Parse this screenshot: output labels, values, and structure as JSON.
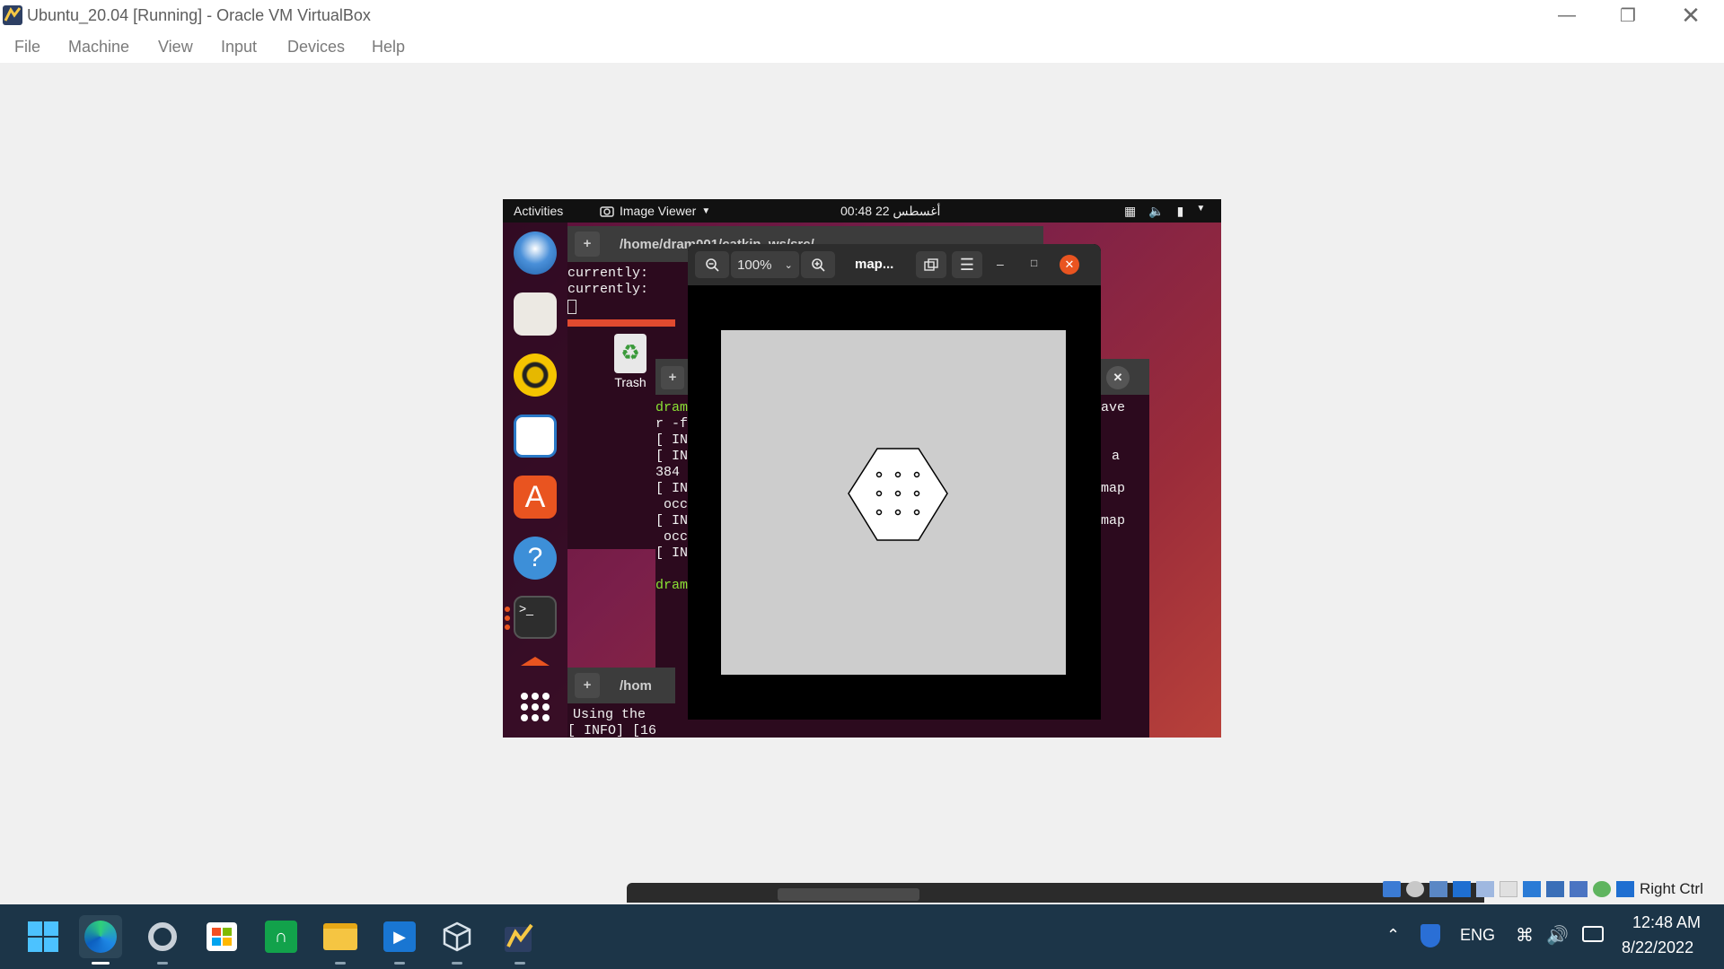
{
  "window": {
    "title": "Ubuntu_20.04 [Running] - Oracle VM VirtualBox",
    "menu": [
      "File",
      "Machine",
      "View",
      "Input",
      "Devices",
      "Help"
    ]
  },
  "ubuntu": {
    "activities": "Activities",
    "app_menu": "Image Viewer",
    "clock": "00:48 أغسطس 22",
    "desktop_trash_label": "Trash"
  },
  "terminal_back": {
    "title": "/home/dram001/catkin_ws/src/",
    "lines": [
      "currently:",
      "currently:"
    ]
  },
  "terminal_mid": {
    "lines": [
      "dram",
      "r -f",
      "[ IN",
      "[ IN",
      "384",
      "[ IN",
      " occ",
      "[ IN",
      " occ",
      "[ IN",
      "",
      "dram"
    ],
    "right_lines": [
      "ave",
      "",
      "a",
      "map",
      "map"
    ]
  },
  "terminal_bottom": {
    "title": "/hom",
    "lines": [
      "Using the",
      "[ INFO] [16"
    ]
  },
  "image_viewer": {
    "zoom": "100%",
    "title": "map..."
  },
  "host_status": {
    "right_ctrl": "Right Ctrl"
  },
  "taskbar": {
    "lang": "ENG",
    "time": "12:48 AM",
    "date": "8/22/2022"
  },
  "colors": {
    "ubuntu_orange": "#e95420",
    "taskbar_bg": "#1c3548",
    "terminal_green": "#8ae234"
  }
}
